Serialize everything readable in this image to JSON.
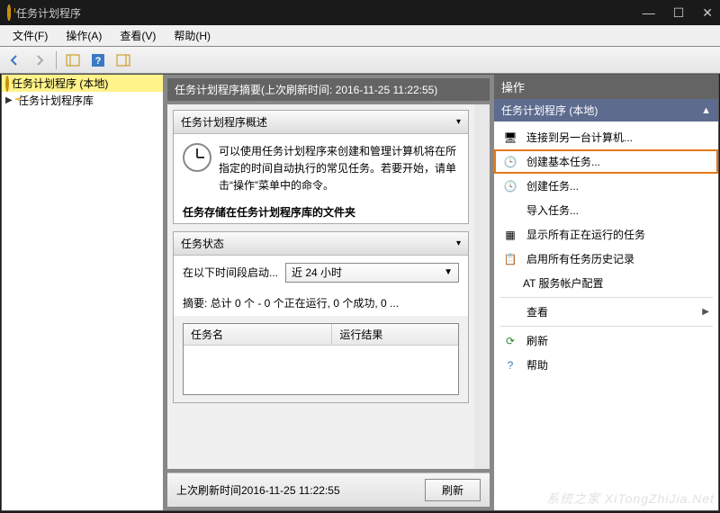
{
  "window": {
    "title": "任务计划程序"
  },
  "menu": {
    "file": "文件(F)",
    "action": "操作(A)",
    "view": "查看(V)",
    "help": "帮助(H)"
  },
  "tree": {
    "root": "任务计划程序 (本地)",
    "library": "任务计划程序库"
  },
  "center": {
    "header": "任务计划程序摘要(上次刷新时间: 2016-11-25 11:22:55)",
    "overview_title": "任务计划程序概述",
    "overview_text": "可以使用任务计划程序来创建和管理计算机将在所指定的时间自动执行的常见任务。若要开始，请单击“操作”菜单中的命令。",
    "overview_text2": "任务存储在任务计划程序库的文件夹",
    "status_title": "任务状态",
    "status_label": "在以下时间段启动...",
    "status_dropdown": "近 24 小时",
    "summary": "摘要: 总计 0 个 - 0 个正在运行, 0 个成功, 0 ...",
    "col_name": "任务名",
    "col_result": "运行结果",
    "footer_time": "上次刷新时间2016-11-25 11:22:55",
    "refresh_btn": "刷新"
  },
  "actions": {
    "title": "操作",
    "subtitle": "任务计划程序 (本地)",
    "items": {
      "connect": "连接到另一台计算机...",
      "create_basic": "创建基本任务...",
      "create": "创建任务...",
      "import": "导入任务...",
      "show_running": "显示所有正在运行的任务",
      "enable_history": "启用所有任务历史记录",
      "at_config": "AT 服务帐户配置",
      "view": "查看",
      "refresh": "刷新",
      "help": "帮助"
    }
  },
  "watermark": "系统之家 XiTongZhiJia.Net"
}
